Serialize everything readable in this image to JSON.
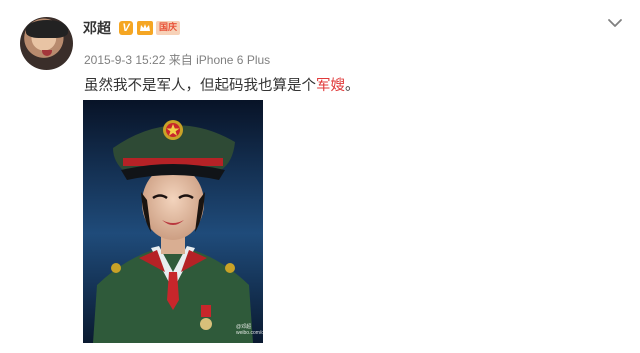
{
  "post": {
    "author": "邓超",
    "verified_mark": "V",
    "event_badge": "国庆",
    "timestamp": "2015-9-3 15:22",
    "source_prefix": "来自",
    "source": "iPhone 6 Plus",
    "text_before": "虽然我不是军人，但起码我也算是个",
    "text_highlight": "军嫂",
    "text_after": "。",
    "watermark_handle": "@邓超",
    "watermark_url": "weibo.com/dengchao"
  },
  "colors": {
    "name": "#333333",
    "meta": "#808080",
    "highlight": "#e03a3a",
    "verified": "#f5a623"
  },
  "icons": {
    "menu": "chevron-down-icon",
    "member": "crown-icon",
    "weibo": "weibo-logo-icon"
  }
}
